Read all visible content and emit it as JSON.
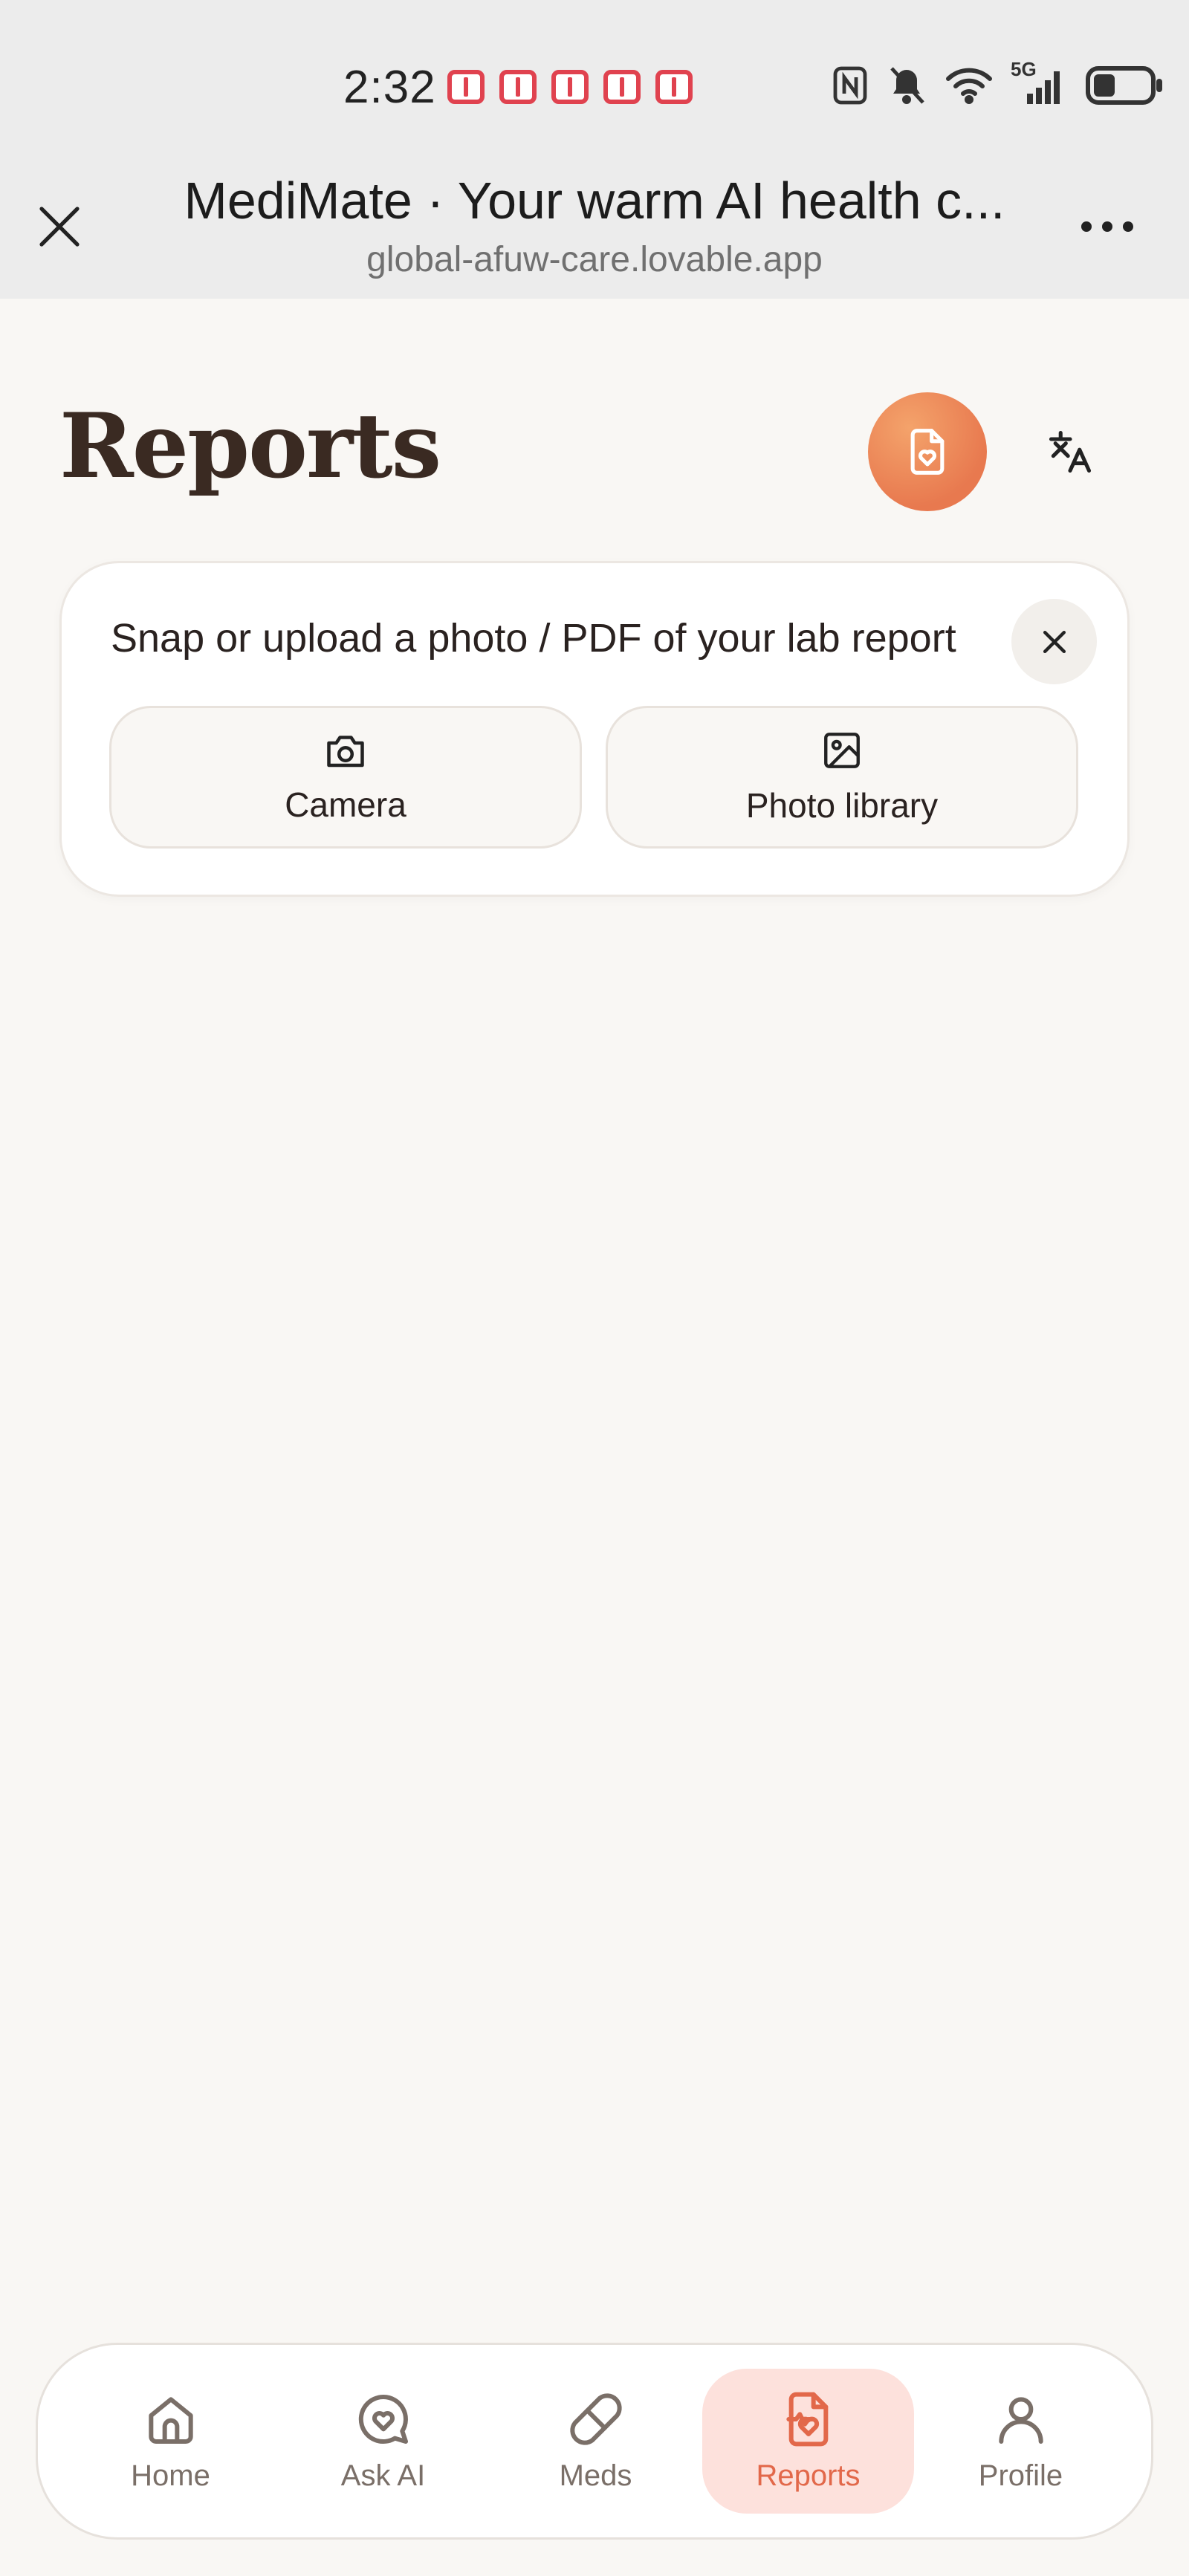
{
  "status_bar": {
    "time": "2:32",
    "network_label": "5G"
  },
  "browser": {
    "page_title": "MediMate · Your warm AI health c...",
    "url": "global-afuw-care.lovable.app"
  },
  "header": {
    "title": "Reports"
  },
  "upload_card": {
    "prompt": "Snap or upload a photo / PDF of your lab report",
    "camera_label": "Camera",
    "library_label": "Photo library"
  },
  "bottom_nav": {
    "items": [
      {
        "label": "Home",
        "icon": "home-icon",
        "active": false
      },
      {
        "label": "Ask AI",
        "icon": "chat-heart-icon",
        "active": false
      },
      {
        "label": "Meds",
        "icon": "pill-icon",
        "active": false
      },
      {
        "label": "Reports",
        "icon": "file-heart-icon",
        "active": true
      },
      {
        "label": "Profile",
        "icon": "user-icon",
        "active": false
      }
    ]
  },
  "colors": {
    "accent": "#e8794f",
    "active_nav_bg": "#fde1dc",
    "title_text": "#3a2a22",
    "background": "#f9f7f4"
  }
}
